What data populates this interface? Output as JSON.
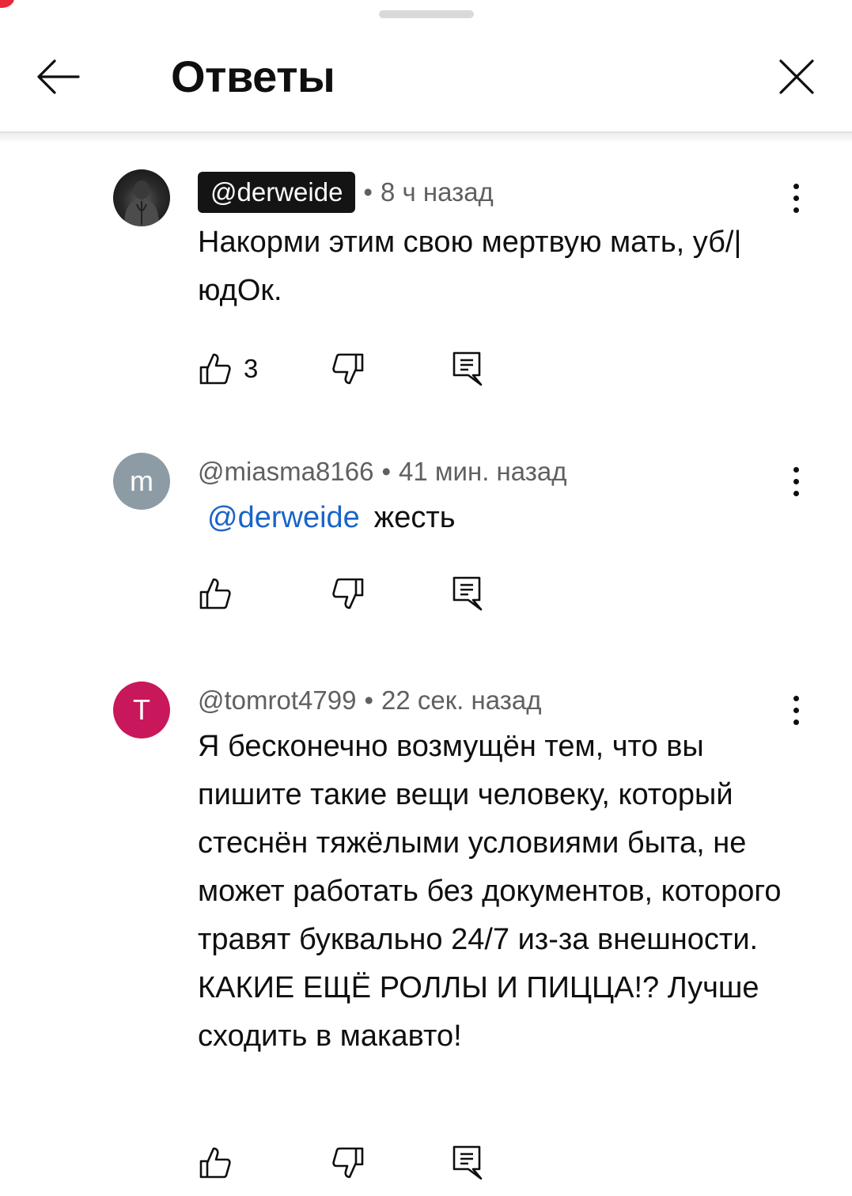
{
  "header": {
    "title": "Ответы"
  },
  "comments": [
    {
      "avatar_letter": "",
      "author": "@derweide",
      "time": "8 ч назад",
      "text": "Накорми этим свою мертвую мать, уб/|юдОк.",
      "likes": "3"
    },
    {
      "avatar_letter": "m",
      "author": "@miasma8166",
      "time": "41 мин. назад",
      "mention": "@derweide",
      "text": "жесть",
      "likes": ""
    },
    {
      "avatar_letter": "T",
      "author": "@tomrot4799",
      "time": "22 сек. назад",
      "text": "Я бесконечно возмущён тем, что вы пишите такие вещи человеку, который стеснён тяжёлыми условиями быта, не может работать без документов, которого травят буквально 24/7 из-за внешности. КАКИЕ ЕЩЁ РОЛЛЫ И ПИЦЦА!? Лучше сходить в макавто!",
      "likes": ""
    }
  ],
  "icons": {
    "back": "arrow-left-icon",
    "close": "close-icon",
    "more": "more-vertical-icon",
    "like": "thumbs-up-icon",
    "dislike": "thumbs-down-icon",
    "reply": "reply-comment-icon"
  },
  "colors": {
    "mention": "#1a64c8",
    "avatar_m": "#8c9ba4",
    "avatar_t": "#c8175a",
    "chip_bg": "#141414"
  }
}
